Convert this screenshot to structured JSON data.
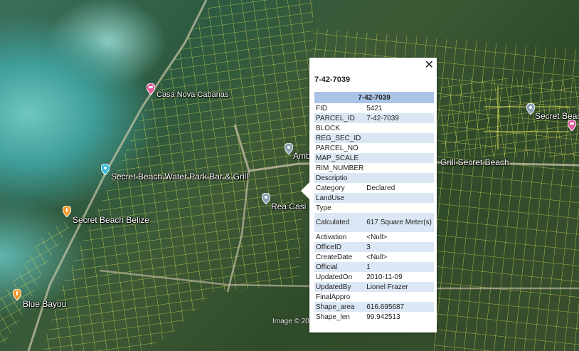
{
  "map": {
    "attribution": "Image © 20",
    "places": [
      {
        "name": "Casa Nova Cabanas",
        "color": "#e05a9a"
      },
      {
        "name": "Secret Beach Water Park Bar & Grill",
        "color": "#3bbbd6"
      },
      {
        "name": "Secret Beach Belize",
        "color": "#f39a2b"
      },
      {
        "name": "Blue Bayou",
        "color": "#f39a2b"
      },
      {
        "name": "Amb",
        "color": "#8aa0b0"
      },
      {
        "name": "Rea Casi",
        "color": "#8aa0b0"
      },
      {
        "name": "Grill Secret Beach",
        "color": ""
      },
      {
        "name": "Secret Beach",
        "color": "#8aa0b0"
      },
      {
        "name": "",
        "color": "#e05a9a"
      }
    ]
  },
  "popup": {
    "title": "7-42-7039",
    "close_label": "✕",
    "header": "7-42-7039",
    "rows": [
      {
        "key": "FID",
        "value": "5421"
      },
      {
        "key": "PARCEL_ID",
        "value": "7-42-7039"
      },
      {
        "key": "BLOCK",
        "value": ""
      },
      {
        "key": "REG_SEC_ID",
        "value": ""
      },
      {
        "key": "PARCEL_NO",
        "value": ""
      },
      {
        "key": "MAP_SCALE",
        "value": ""
      },
      {
        "key": "RIM_NUMBER",
        "value": ""
      },
      {
        "key": "Descriptio",
        "value": ""
      },
      {
        "key": "Category",
        "value": "Declared"
      },
      {
        "key": "LandUse",
        "value": ""
      },
      {
        "key": "Type",
        "value": ""
      },
      {
        "key": "Calculated",
        "value": "617 Square Meter(s)"
      },
      {
        "key": "Activation",
        "value": "<Null>"
      },
      {
        "key": "OfficeID",
        "value": "3"
      },
      {
        "key": "CreateDate",
        "value": "<Null>"
      },
      {
        "key": "Official",
        "value": "1"
      },
      {
        "key": "UpdatedOn",
        "value": "2010-11-09"
      },
      {
        "key": "UpdatedBy",
        "value": "Lionel Frazer"
      },
      {
        "key": "FinalAppro",
        "value": ""
      },
      {
        "key": "Shape_area",
        "value": "616.695687"
      },
      {
        "key": "Shape_len",
        "value": "99.942513"
      }
    ]
  }
}
